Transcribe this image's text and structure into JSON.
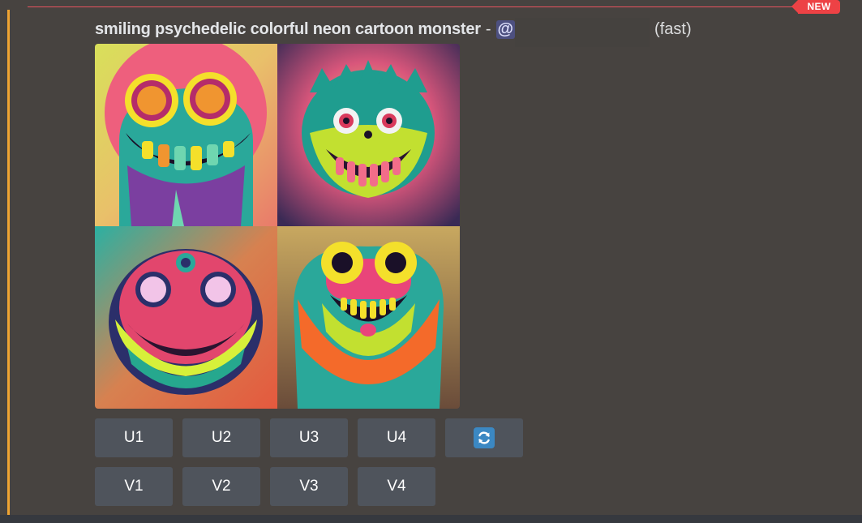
{
  "badge": {
    "new_label": "NEW"
  },
  "message": {
    "prompt": "smiling psychedelic colorful neon cartoon monster",
    "separator": "-",
    "mention": "@",
    "speed": "(fast)"
  },
  "images": [
    {
      "name": "monster-1"
    },
    {
      "name": "monster-2"
    },
    {
      "name": "monster-3"
    },
    {
      "name": "monster-4"
    }
  ],
  "buttons": {
    "upscale": [
      "U1",
      "U2",
      "U3",
      "U4"
    ],
    "variation": [
      "V1",
      "V2",
      "V3",
      "V4"
    ],
    "reroll_icon": "refresh-icon"
  },
  "colors": {
    "accent": "#f0a432",
    "new_badge": "#ed4245",
    "mention_bg": "#4d5080",
    "button_bg": "#4f545c",
    "refresh_blue": "#3b88c3"
  }
}
